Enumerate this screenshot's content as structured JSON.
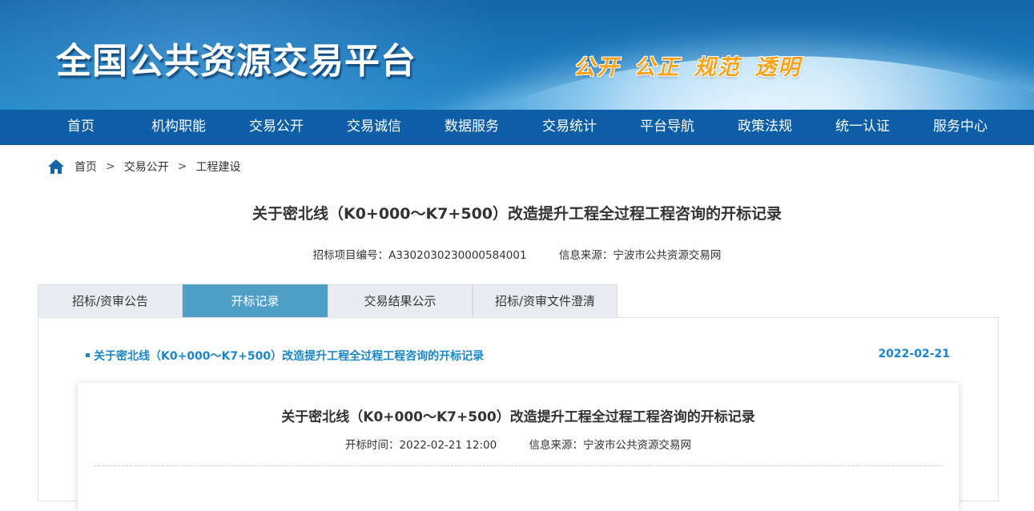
{
  "header": {
    "site_title": "全国公共资源交易平台",
    "slogan": "公开 公正 规范 透明"
  },
  "nav": {
    "items": [
      "首页",
      "机构职能",
      "交易公开",
      "交易诚信",
      "数据服务",
      "交易统计",
      "平台导航",
      "政策法规",
      "统一认证",
      "服务中心"
    ]
  },
  "breadcrumb": {
    "icon": "home-icon",
    "items": [
      "首页",
      "交易公开",
      "工程建设"
    ],
    "separator": ">"
  },
  "article": {
    "title": "关于密北线（K0+000～K7+500）改造提升工程全过程工程咨询的开标记录",
    "project_no": "招标项目编号：A3302030230000584001",
    "source": "信息来源：宁波市公共资源交易网"
  },
  "tabs": {
    "items": [
      "招标/资审公告",
      "开标记录",
      "交易结果公示",
      "招标/资审文件澄清"
    ],
    "active_index": 1
  },
  "list": {
    "item_title": "关于密北线（K0+000～K7+500）改造提升工程全过程工程咨询的开标记录",
    "item_date": "2022-02-21"
  },
  "detail": {
    "title": "关于密北线（K0+000～K7+500）改造提升工程全过程工程咨询的开标记录",
    "open_time": "开标时间：2022-02-21 12:00",
    "source": "信息来源：宁波市公共资源交易网"
  },
  "colors": {
    "nav_bg": "#0d5ea6",
    "active_tab": "#4f9fc7",
    "link": "#1a86c8",
    "slogan": "#f7a21b"
  }
}
